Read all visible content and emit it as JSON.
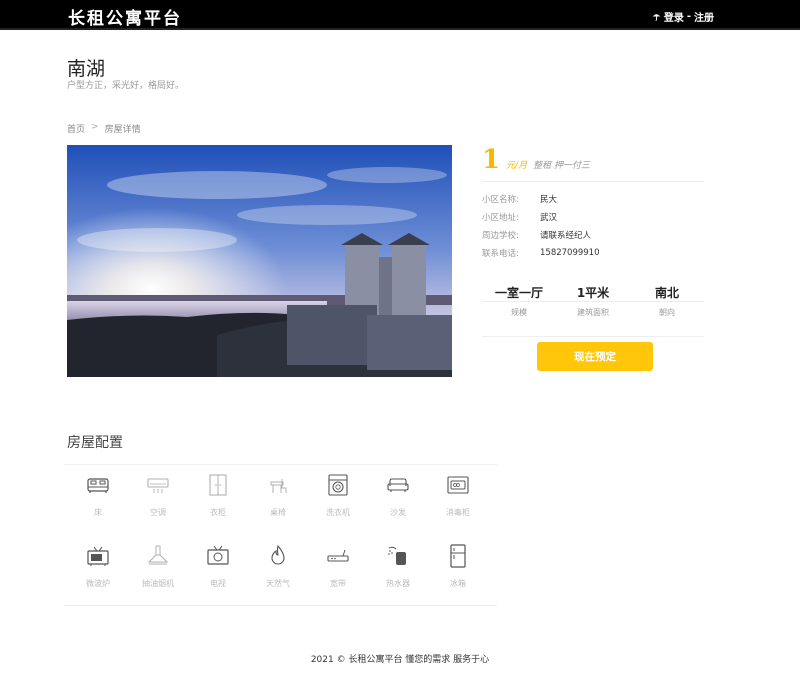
{
  "header": {
    "brand": "长租公寓平台",
    "login": "登录",
    "sep": "-",
    "register": "注册"
  },
  "listing": {
    "title": "南湖",
    "subtitle": "户型方正，采光好，格局好。"
  },
  "breadcrumb": {
    "home": "首页",
    "sep": ">",
    "current": "房屋详情"
  },
  "price": {
    "amount": "1",
    "unit": "元/月",
    "terms": "整租 押一付三"
  },
  "details": [
    {
      "label": "小区名称:",
      "value": "民大"
    },
    {
      "label": "小区地址:",
      "value": "武汉"
    },
    {
      "label": "周边学校:",
      "value": "请联系经纪人"
    },
    {
      "label": "联系电话:",
      "value": "15827099910"
    }
  ],
  "specs": [
    {
      "value": "一室一厅",
      "label": "规模"
    },
    {
      "value": "1平米",
      "label": "建筑面积"
    },
    {
      "value": "南北",
      "label": "朝向"
    }
  ],
  "reserve_label": "现在预定",
  "config_title": "房屋配置",
  "amenities": [
    {
      "name": "床",
      "icon": "bed-icon",
      "available": true
    },
    {
      "name": "空调",
      "icon": "air-conditioner-icon",
      "available": false
    },
    {
      "name": "衣柜",
      "icon": "wardrobe-icon",
      "available": false
    },
    {
      "name": "桌椅",
      "icon": "desk-chair-icon",
      "available": false
    },
    {
      "name": "洗衣机",
      "icon": "washing-machine-icon",
      "available": true
    },
    {
      "name": "沙发",
      "icon": "sofa-icon",
      "available": true
    },
    {
      "name": "消毒柜",
      "icon": "sterilizer-icon",
      "available": true
    },
    {
      "name": "微波炉",
      "icon": "microwave-icon",
      "available": true
    },
    {
      "name": "抽油烟机",
      "icon": "range-hood-icon",
      "available": false
    },
    {
      "name": "电视",
      "icon": "tv-icon",
      "available": true
    },
    {
      "name": "天然气",
      "icon": "gas-flame-icon",
      "available": true
    },
    {
      "name": "宽带",
      "icon": "router-icon",
      "available": true
    },
    {
      "name": "热水器",
      "icon": "water-heater-icon",
      "available": true
    },
    {
      "name": "冰箱",
      "icon": "fridge-icon",
      "available": true
    }
  ],
  "footer": "2021 © 长租公寓平台 懂您的需求 服务于心",
  "colors": {
    "accent": "#ffc60a",
    "price": "#f5b800",
    "topbar": "#000000"
  }
}
